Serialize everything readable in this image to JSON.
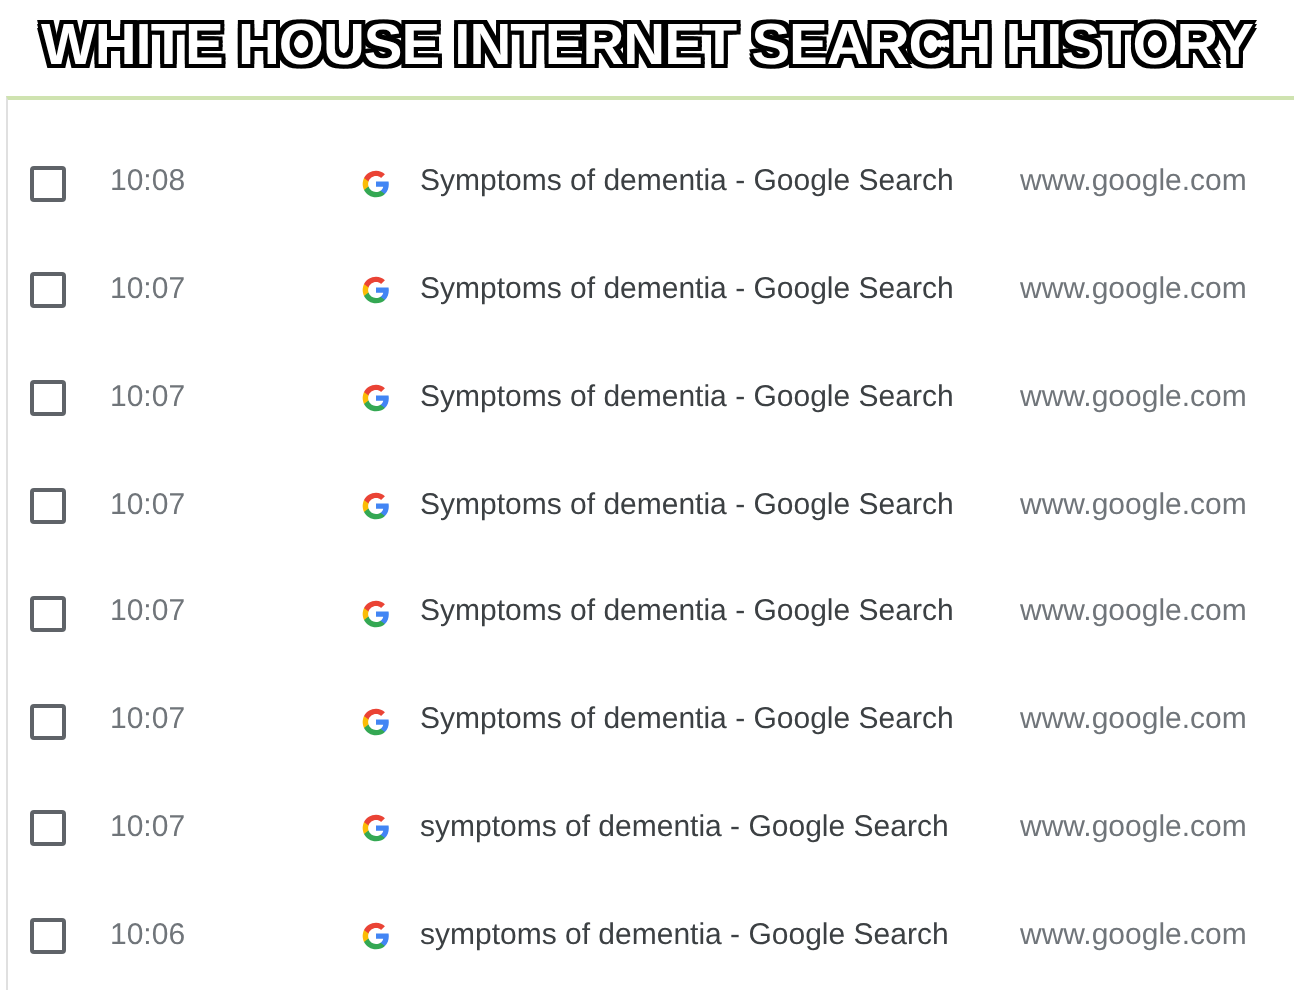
{
  "caption": "WHITE HOUSE INTERNET SEARCH HISTORY",
  "history": [
    {
      "checked": false,
      "time": "10:08",
      "title": "Symptoms of dementia - Google Search",
      "url": "www.google.com"
    },
    {
      "checked": false,
      "time": "10:07",
      "title": "Symptoms of dementia - Google Search",
      "url": "www.google.com"
    },
    {
      "checked": false,
      "time": "10:07",
      "title": "Symptoms of dementia - Google Search",
      "url": "www.google.com"
    },
    {
      "checked": false,
      "time": "10:07",
      "title": "Symptoms of dementia - Google Search",
      "url": "www.google.com"
    },
    {
      "checked": false,
      "time": "10:07",
      "title": "Symptoms of dementia - Google Search",
      "url": "www.google.com"
    },
    {
      "checked": false,
      "time": "10:07",
      "title": "Symptoms of dementia - Google Search",
      "url": "www.google.com"
    },
    {
      "checked": false,
      "time": "10:07",
      "title": "symptoms of dementia - Google Search",
      "url": "www.google.com"
    },
    {
      "checked": false,
      "time": "10:06",
      "title": "symptoms of dementia - Google Search",
      "url": "www.google.com"
    }
  ]
}
